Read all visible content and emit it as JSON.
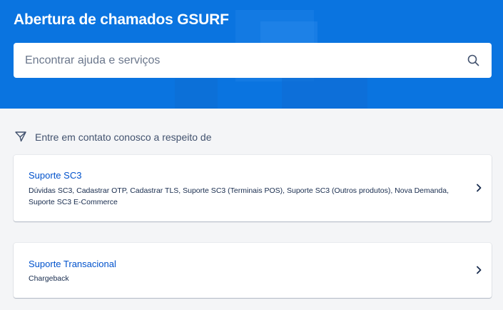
{
  "header": {
    "title": "Abertura de chamados GSURF"
  },
  "search": {
    "placeholder": "Encontrar ajuda e serviços",
    "icon": "search-icon"
  },
  "section": {
    "label": "Entre em contato conosco a respeito de",
    "icon": "send-icon"
  },
  "cards": [
    {
      "title": "Suporte SC3",
      "description": "Dúvidas SC3, Cadastrar OTP, Cadastrar TLS, Suporte SC3 (Terminais POS), Suporte SC3 (Outros produtos), Nova Demanda, Suporte SC3 E-Commerce"
    },
    {
      "title": "Suporte Transacional",
      "description": "Chargeback"
    }
  ],
  "colors": {
    "hero": "#0a74e0",
    "link": "#0052cc",
    "background": "#f4f5f7"
  }
}
